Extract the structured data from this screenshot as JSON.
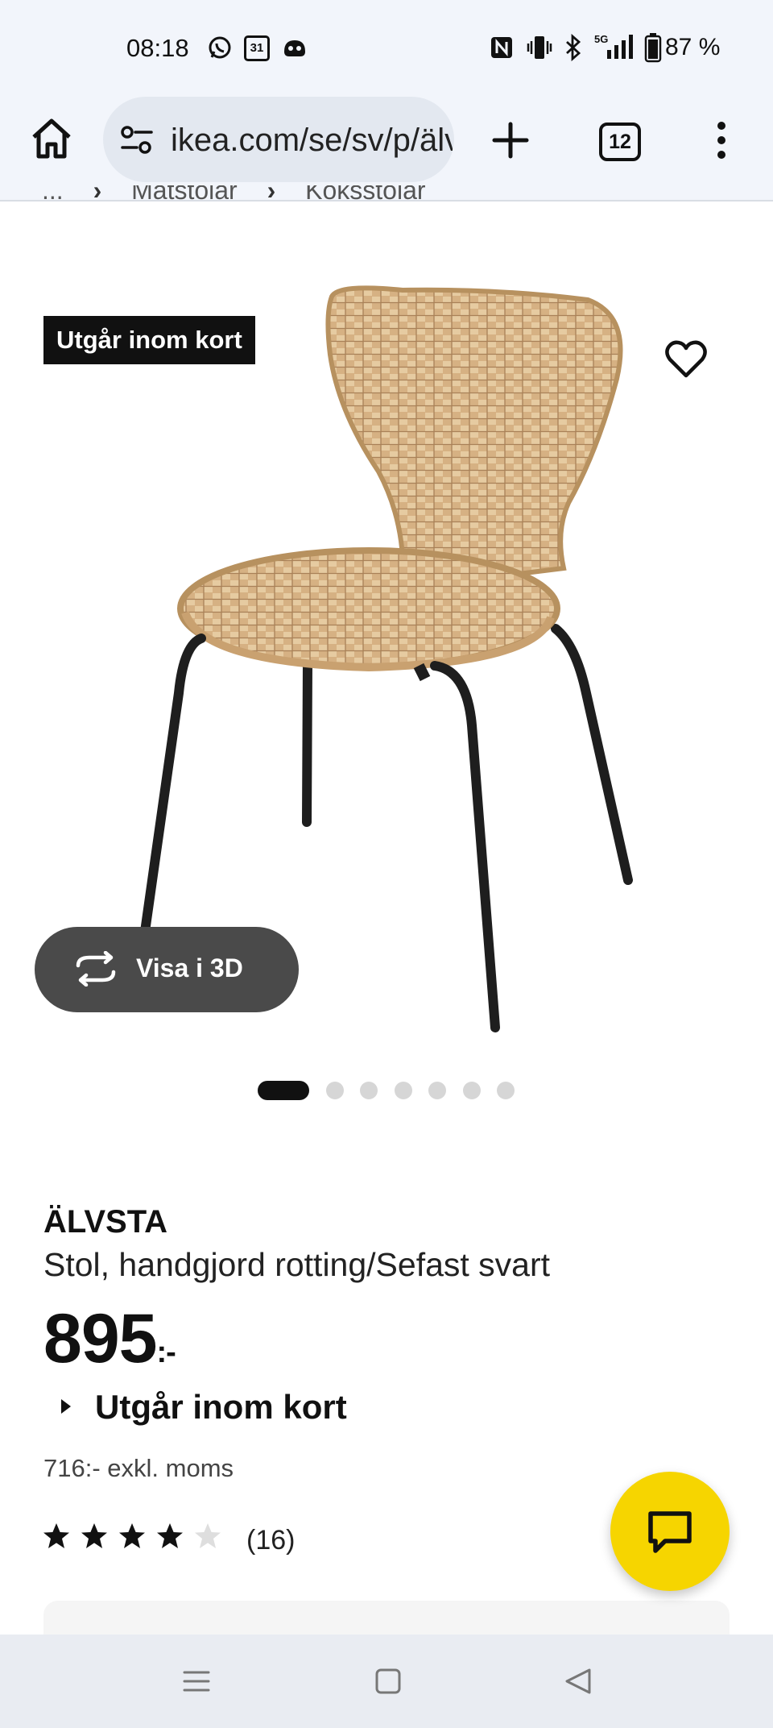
{
  "status_bar": {
    "time": "08:18",
    "icons": [
      "whatsapp-icon",
      "calendar-icon",
      "game-controller-icon",
      "nfc-icon",
      "vibrate-icon",
      "bluetooth-icon",
      "5g-signal-icon",
      "battery-icon"
    ],
    "calendar_day": "31",
    "network": "5G",
    "battery": "87 %"
  },
  "browser": {
    "url": "ikea.com/se/sv/p/älvsta",
    "tab_count": "12"
  },
  "breadcrumb": [
    "...",
    "Matstolar",
    "Köksstolar"
  ],
  "gallery": {
    "badge": "Utgår inom kort",
    "view_3d_label": "Visa i 3D",
    "image_count": 7,
    "active_image_index": 0
  },
  "product": {
    "name": "ÄLVSTA",
    "description": "Stol, handgjord rotting/Sefast svart",
    "price": "895",
    "price_suffix": ":-",
    "availability": "Utgår inom kort",
    "price_excl_vat": "716:- exkl. moms",
    "rating": 4,
    "rating_max": 5,
    "review_count": "(16)"
  },
  "colors": {
    "chat_button": "#f6d500",
    "badge_bg": "#111111",
    "view3d_bg": "#4a4a4a",
    "chair_rattan": "#d2ac7c",
    "chair_legs": "#1e1e1e"
  }
}
